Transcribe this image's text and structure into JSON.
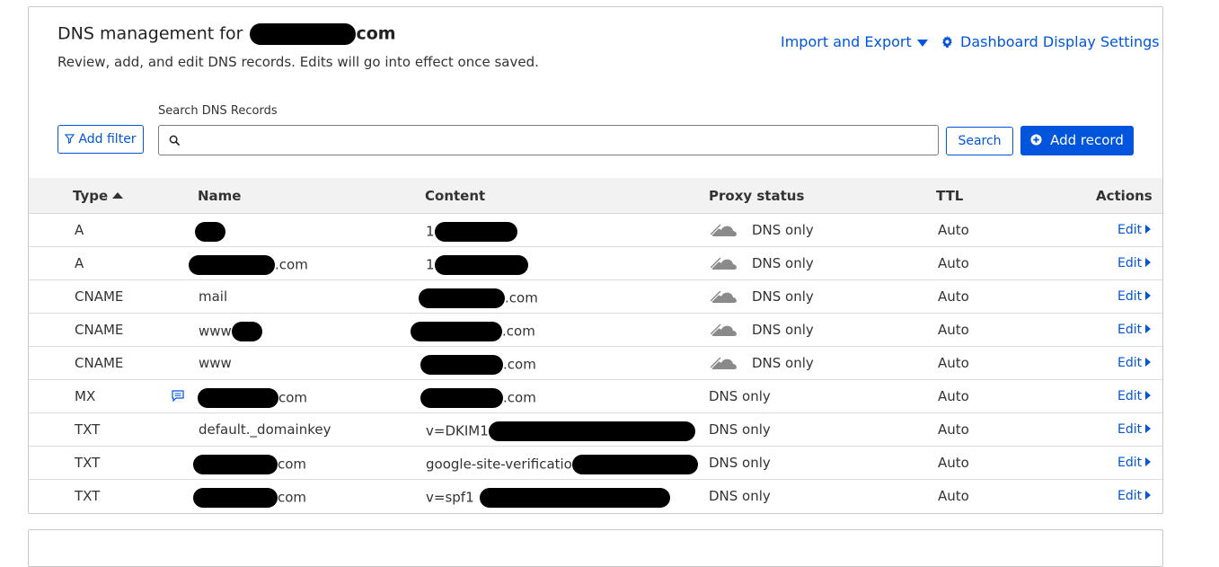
{
  "header": {
    "title_prefix": "DNS management for ",
    "title_suffix": "com",
    "subtitle": "Review, add, and edit DNS records. Edits will go into effect once saved.",
    "import_export_label": "Import and Export",
    "dashboard_settings_label": "Dashboard Display Settings"
  },
  "toolbar": {
    "add_filter_label": "Add filter",
    "search_label": "Search DNS Records",
    "search_value": "",
    "search_button_label": "Search",
    "add_record_label": "Add record"
  },
  "table": {
    "columns": [
      "Type",
      "Name",
      "Content",
      "Proxy status",
      "TTL",
      "Actions"
    ],
    "rows": [
      {
        "type": "A",
        "name": "",
        "content": "1",
        "proxy": "DNS only",
        "ttl": "Auto",
        "action": "Edit"
      },
      {
        "type": "A",
        "name": ".com",
        "content": "1",
        "proxy": "DNS only",
        "ttl": "Auto",
        "action": "Edit"
      },
      {
        "type": "CNAME",
        "name": "mail",
        "content": ".com",
        "proxy": "DNS only",
        "ttl": "Auto",
        "action": "Edit"
      },
      {
        "type": "CNAME",
        "name": "www",
        "content": ".com",
        "proxy": "DNS only",
        "ttl": "Auto",
        "action": "Edit"
      },
      {
        "type": "CNAME",
        "name": "www",
        "content": ".com",
        "proxy": "DNS only",
        "ttl": "Auto",
        "action": "Edit"
      },
      {
        "type": "MX",
        "name": "com",
        "content": ".com",
        "proxy": "DNS only",
        "ttl": "Auto",
        "action": "Edit"
      },
      {
        "type": "TXT",
        "name": "default._domainkey",
        "content": "v=DKIM1",
        "proxy": "DNS only",
        "ttl": "Auto",
        "action": "Edit"
      },
      {
        "type": "TXT",
        "name": "com",
        "content": "google-site-verificatio",
        "proxy": "DNS only",
        "ttl": "Auto",
        "action": "Edit"
      },
      {
        "type": "TXT",
        "name": "com",
        "content": "v=spf1",
        "proxy": "DNS only",
        "ttl": "Auto",
        "action": "Edit"
      }
    ]
  },
  "icons": {
    "filter": "filter-icon",
    "search": "search-icon",
    "gear": "gear-icon",
    "plus_circle": "plus-circle-icon",
    "cloud": "cloud-icon",
    "note": "note-icon"
  },
  "colors": {
    "accent": "#0055dc",
    "header_bg": "#f2f2f2",
    "redaction": "#000000",
    "cloud_grey": "#8a8a8a"
  }
}
